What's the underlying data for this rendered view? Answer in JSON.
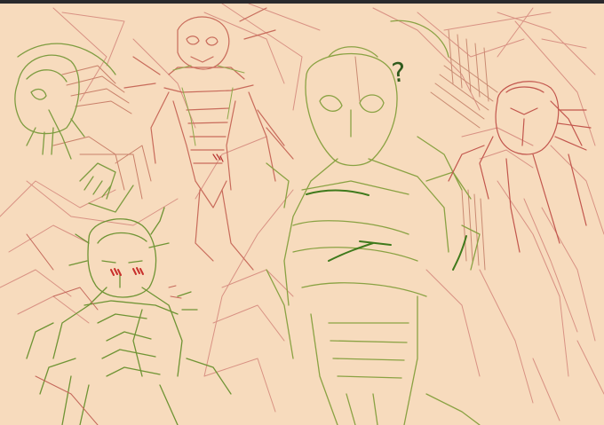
{
  "canvas": {
    "background_color": "#f7dbbd",
    "sketch_colors": {
      "red_lines": "#cf7a66",
      "green_lines": "#7a9a3a",
      "dark_green_lines": "#3f7a1c",
      "blush": "#c93a3a"
    },
    "annotation_text": "?"
  },
  "window": {
    "top_bar_color": "#2a2a2d"
  }
}
